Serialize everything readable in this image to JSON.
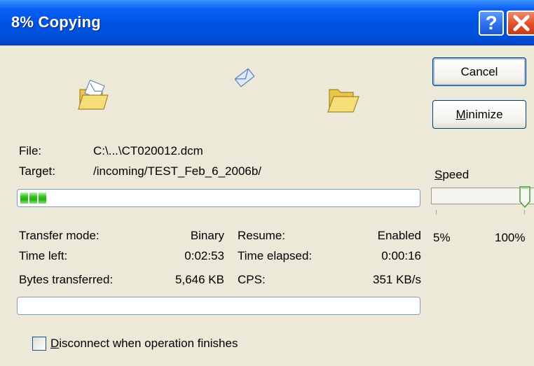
{
  "window": {
    "title": "8% Copying",
    "help_glyph": "?",
    "close_glyph": "✕"
  },
  "buttons": {
    "cancel": "Cancel",
    "minimize_mnemonic": "M",
    "minimize_rest": "inimize"
  },
  "icons": {
    "source": "folder-envelope-icon",
    "transfer": "flying-envelope-icon",
    "destination": "open-folder-icon"
  },
  "file": {
    "file_label": "File:",
    "file_value": "C:\\...\\CT020012.dcm",
    "target_label": "Target:",
    "target_value": "/incoming/TEST_Feb_6_2006b/"
  },
  "progress": {
    "current_percent": 8,
    "total_percent": 0
  },
  "speed": {
    "label_mnemonic": "S",
    "label_rest": "peed",
    "min_label": "5%",
    "max_label": "100%",
    "value_percent": 100
  },
  "stats": {
    "transfer_mode_label": "Transfer mode:",
    "transfer_mode_value": "Binary",
    "resume_label": "Resume:",
    "resume_value": "Enabled",
    "time_left_label": "Time left:",
    "time_left_value": "0:02:53",
    "time_elapsed_label": "Time elapsed:",
    "time_elapsed_value": "0:00:16",
    "bytes_label": "Bytes transferred:",
    "bytes_value": "5,646 KB",
    "cps_label": "CPS:",
    "cps_value": "351 KB/s"
  },
  "disconnect": {
    "checked": false,
    "label_mnemonic": "D",
    "label_rest": "isconnect when operation finishes"
  },
  "colors": {
    "titlebar": "#0054e3",
    "progress_fill": "#22b10e",
    "dialog_background": "#ece9d8"
  }
}
